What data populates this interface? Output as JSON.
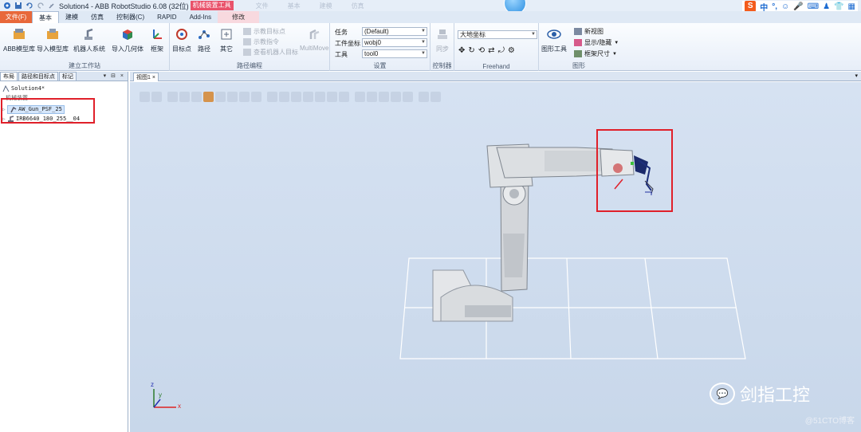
{
  "titlebar": {
    "title": "Solution4 - ABB RobotStudio 6.08 (32位)",
    "context_label": "机械装置工具",
    "faded_tabs": [
      "文件",
      "基本",
      "建模",
      "仿真"
    ],
    "sogou": {
      "logo": "S",
      "items": [
        "中",
        "°,",
        "☺",
        "🎤",
        "⌨",
        "♟",
        "👕",
        "▦"
      ]
    }
  },
  "tabs": [
    {
      "label": "文件(F)"
    },
    {
      "label": "基本"
    },
    {
      "label": "建模"
    },
    {
      "label": "仿真"
    },
    {
      "label": "控制器(C)"
    },
    {
      "label": "RAPID"
    },
    {
      "label": "Add-Ins"
    },
    {
      "label": "修改"
    }
  ],
  "ribbon": {
    "build": {
      "label": "建立工作站",
      "abb_lib": "ABB模型库",
      "import_lib": "导入模型库",
      "robot_sys": "机器人系统",
      "import_geo": "导入几何体",
      "frame": "框架"
    },
    "path": {
      "label": "路径编程",
      "target": "目标点",
      "path": "路径",
      "other": "其它",
      "teach_target": "示教目标点",
      "teach_instr": "示教指令",
      "view_robot_target": "查看机器人目标",
      "multimove": "MultiMove"
    },
    "settings": {
      "label": "设置",
      "task_label": "任务",
      "task_value": "(Default)",
      "wobj_label": "工件坐标",
      "wobj_value": "wobj0",
      "tool_label": "工具",
      "tool_value": "tool0"
    },
    "controller": {
      "label": "控制器",
      "sync": "同步"
    },
    "freehand": {
      "label": "Freehand",
      "coord_value": "大地坐标"
    },
    "graphics": {
      "label": "图形",
      "graphic_tools": "图形工具",
      "new_view": "新视图",
      "show_hide": "显示/隐藏",
      "frame_size": "框架尺寸"
    }
  },
  "left_panel": {
    "tabs": [
      "布局",
      "路径和目标点",
      "标记"
    ],
    "controls": "▾ ⊟ ×",
    "tree": {
      "root": "Solution4*",
      "group": "机械装置",
      "items": [
        "AW_Gun_PSF_25",
        "IRB6640_180_255__04"
      ]
    }
  },
  "viewport": {
    "tab": "视图1",
    "controls": "▾",
    "axes": {
      "x": "x",
      "y": "y",
      "z": "z"
    },
    "watermark": "剑指工控",
    "watermark2": "@51CTO博客"
  },
  "colors": {
    "file_tab": "#e8683a",
    "context_tab": "#e9536b",
    "highlight_box": "#e0202a",
    "viewport_bg": "#cfdcee"
  }
}
